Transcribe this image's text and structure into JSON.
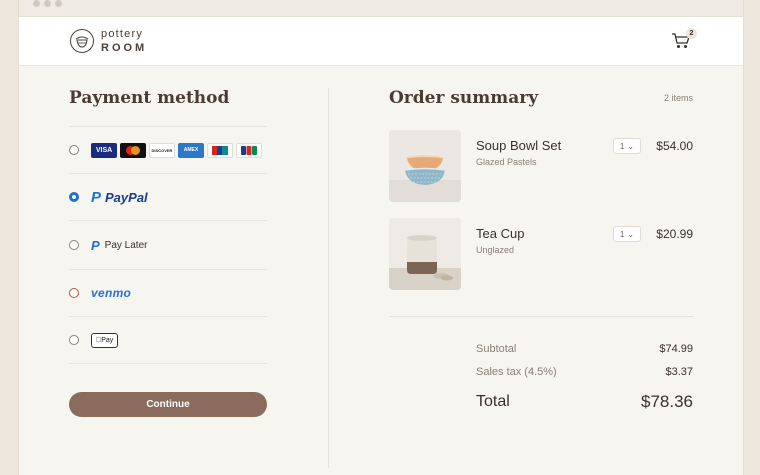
{
  "brand": {
    "line1": "pottery",
    "line2": "ROOM"
  },
  "header": {
    "cart_count": "2"
  },
  "payment": {
    "title": "Payment method",
    "cards": [
      "VISA",
      "MC",
      "DISCOVER",
      "AMEX",
      "UnionPay",
      "JCB"
    ],
    "options": [
      {
        "id": "cards",
        "selected": false
      },
      {
        "id": "paypal",
        "label": "PayPal",
        "selected": true
      },
      {
        "id": "paylater",
        "label": "Pay Later",
        "selected": false
      },
      {
        "id": "venmo",
        "label": "venmo",
        "selected": false
      },
      {
        "id": "applepay",
        "label": "Pay",
        "selected": false
      }
    ],
    "continue_label": "Continue"
  },
  "summary": {
    "title": "Order summary",
    "count": "2 items",
    "items": [
      {
        "name": "Soup Bowl Set",
        "variant": "Glazed Pastels",
        "qty": "1",
        "price": "$54.00"
      },
      {
        "name": "Tea Cup",
        "variant": "Unglazed",
        "qty": "1",
        "price": "$20.99"
      }
    ],
    "subtotal_label": "Subtotal",
    "subtotal": "$74.99",
    "tax_label": "Sales tax (4.5%)",
    "tax": "$3.37",
    "total_label": "Total",
    "total": "$78.36"
  },
  "colors": {
    "accent": "#8a6b5e",
    "paypal_blue": "#1f6fd6",
    "background": "#f6f5f0"
  }
}
